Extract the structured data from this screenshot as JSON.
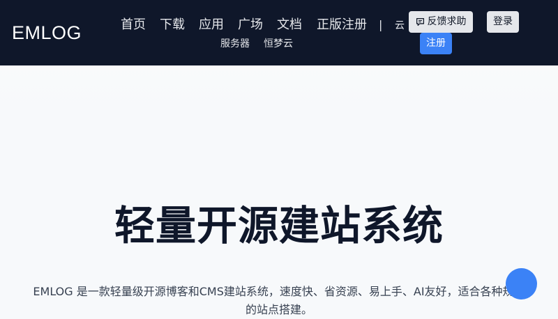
{
  "header": {
    "logo": "EMLOG",
    "nav": [
      "首页",
      "下载",
      "应用",
      "广场",
      "文档",
      "正版注册"
    ],
    "separator": "|",
    "cloud_link": "云",
    "cloud_sub": [
      "服务器",
      "恒梦云"
    ],
    "feedback_icon": "speech-bubble-icon",
    "feedback_label": "反馈求助",
    "login_label": "登录",
    "register_label": "注册"
  },
  "hero": {
    "title": "轻量开源建站系统",
    "description": "EMLOG 是一款轻量级开源博客和CMS建站系统，速度快、省资源、易上手、AI友好，适合各种规模的站点搭建。"
  },
  "colors": {
    "header_bg": "#0f172a",
    "accent": "#3b82f6"
  }
}
